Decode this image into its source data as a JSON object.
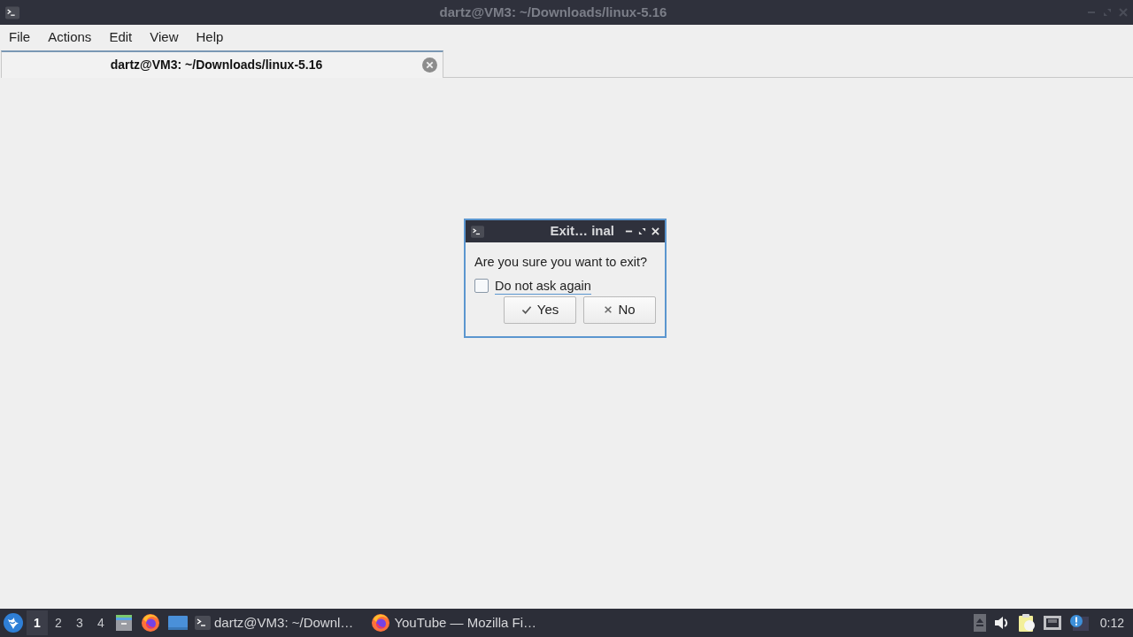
{
  "window": {
    "title": "dartz@VM3: ~/Downloads/linux-5.16"
  },
  "menu": [
    "File",
    "Actions",
    "Edit",
    "View",
    "Help"
  ],
  "tabs": [
    {
      "label": "dartz@VM3: ~/Downloads/linux-5.16",
      "selected": true
    }
  ],
  "dialog": {
    "title": "Exit… inal",
    "message": "Are you sure you want to exit?",
    "checkbox": {
      "label": "Do not ask again",
      "checked": false
    },
    "buttons": [
      {
        "label": "Yes",
        "kind": "yes"
      },
      {
        "label": "No",
        "kind": "no"
      }
    ]
  },
  "taskbar": {
    "desktops": [
      {
        "label": "1",
        "selected": true
      },
      {
        "label": "2",
        "selected": false
      },
      {
        "label": "3",
        "selected": false
      },
      {
        "label": "4",
        "selected": false
      }
    ],
    "tasks": [
      {
        "label": "dartz@VM3: ~/Downl…",
        "kind": "terminal"
      },
      {
        "label": "YouTube — Mozilla Fi…",
        "kind": "browser"
      }
    ],
    "clock": "0:12"
  }
}
